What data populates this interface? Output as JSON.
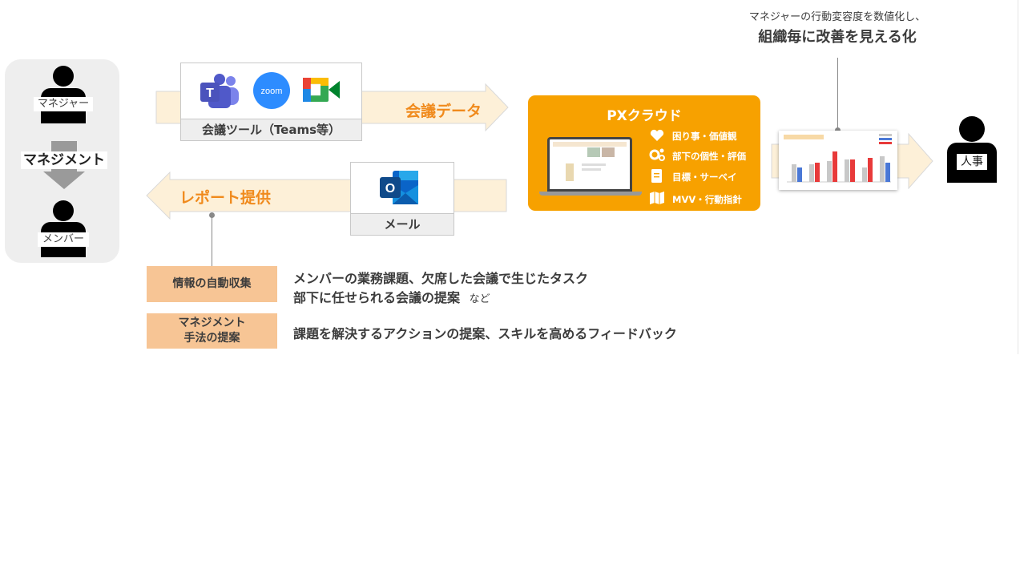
{
  "top_note": {
    "line1": "マネジャーの行動変容度を数値化し、",
    "line2": "組織毎に改善を見える化"
  },
  "left_panel": {
    "manager_label": "マネジャー",
    "management_label": "マネジメント",
    "member_label": "メンバー"
  },
  "meeting_tools": {
    "label": "会議ツール（Teams等）",
    "apps": [
      "teams-icon",
      "zoom-icon",
      "google-meet-icon"
    ],
    "zoom_text": "zoom"
  },
  "arrows": {
    "meeting_data": "会議データ",
    "report": "レポート提供"
  },
  "mail": {
    "label": "メール",
    "app": "outlook-icon"
  },
  "px_cloud": {
    "title": "PXクラウド",
    "features": [
      {
        "icon": "heart-icon",
        "label": "困り事・価値観"
      },
      {
        "icon": "gears-icon",
        "label": "部下の個性・評価"
      },
      {
        "icon": "document-icon",
        "label": "目標・サーベイ"
      },
      {
        "icon": "map-icon",
        "label": "MVV・行動指針"
      }
    ]
  },
  "hr": {
    "label": "人事"
  },
  "info": {
    "rows": [
      {
        "tag": "情報の自動収集",
        "line1": "メンバーの業務課題、欠席した会議で生じたタスク",
        "line2": "部下に任せられる会議の提案",
        "suffix": "など"
      },
      {
        "tag_line1": "マネジメント",
        "tag_line2": "手法の提案",
        "line1": "課題を解決するアクションの提案、スキルを高めるフィードバック"
      }
    ]
  },
  "colors": {
    "orange": "#f7a100",
    "orange_text": "#f08a1c",
    "arrow_fill": "#fdf0d8",
    "tag_fill": "#f7c595",
    "bar_gray": "#c8c8c8",
    "bar_red": "#e83a3a",
    "bar_blue": "#4a78d6"
  }
}
